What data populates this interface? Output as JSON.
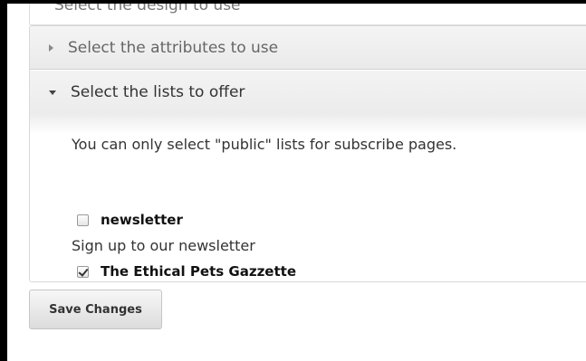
{
  "top_panel": {
    "cut_label": "Select the design to use"
  },
  "accordion": {
    "sections": [
      {
        "label": "Select the attributes to use",
        "expanded": false
      },
      {
        "label": "Select the lists to offer",
        "expanded": true
      }
    ],
    "info_text": "You can only select \"public\" lists for subscribe pages.",
    "lists": [
      {
        "name": "newsletter",
        "checked": false,
        "description": "Sign up to our newsletter"
      },
      {
        "name": "The Ethical Pets Gazzette",
        "checked": true,
        "description": ""
      }
    ]
  },
  "actions": {
    "save_label": "Save Changes"
  },
  "icons": {
    "collapsed": "triangle-right-icon",
    "expanded": "triangle-down-icon"
  },
  "colors": {
    "header_bg": "#f0f0f0",
    "border": "#d8d8d8",
    "text": "#333333"
  }
}
